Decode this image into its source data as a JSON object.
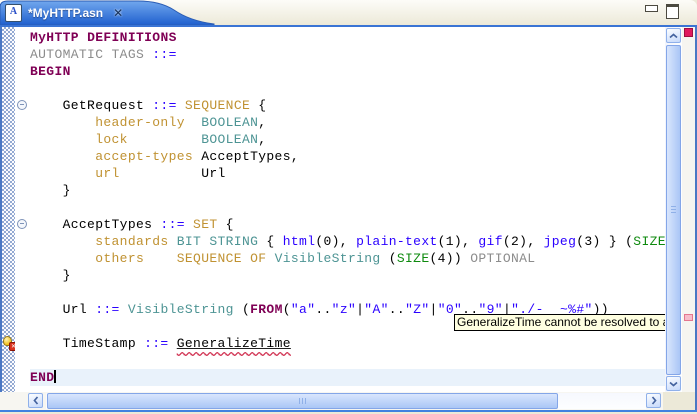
{
  "tab": {
    "title": "*MyHTTP.asn",
    "close_glyph": "✕",
    "icon_letter": "A"
  },
  "tooltip": {
    "text": "GeneralizeTime cannot be resolved to a type"
  },
  "palette": {
    "fg": "#000000",
    "kw": "#7f0055",
    "gray": "#8c8c8c",
    "blue": "#2a00ff",
    "gold": "#c09232",
    "teal": "#4d9494",
    "green": "#0e8a0e",
    "errred": "#d03050",
    "curline": "#e9f2fb",
    "tipbg": "#ffffe1",
    "tab_top": "#71a7ee",
    "tab_bottom": "#1f5fce"
  },
  "editor": {
    "lines": [
      [
        [
          "k",
          "MyHTTP"
        ],
        [
          "d",
          " "
        ],
        [
          "k",
          "DEFINITIONS"
        ]
      ],
      [
        [
          "g",
          "AUTOMATIC TAGS"
        ],
        [
          "d",
          " "
        ],
        [
          "b",
          "::="
        ]
      ],
      [
        [
          "k",
          "BEGIN"
        ]
      ],
      [],
      [
        [
          "d",
          "    GetRequest "
        ],
        [
          "b",
          "::="
        ],
        [
          "d",
          " "
        ],
        [
          "gold",
          "SEQUENCE"
        ],
        [
          "d",
          " {"
        ]
      ],
      [
        [
          "d",
          "        "
        ],
        [
          "gold",
          "header-only"
        ],
        [
          "d",
          "  "
        ],
        [
          "t",
          "BOOLEAN"
        ],
        [
          "d",
          ","
        ]
      ],
      [
        [
          "d",
          "        "
        ],
        [
          "gold",
          "lock"
        ],
        [
          "d",
          "         "
        ],
        [
          "t",
          "BOOLEAN"
        ],
        [
          "d",
          ","
        ]
      ],
      [
        [
          "d",
          "        "
        ],
        [
          "gold",
          "accept-types"
        ],
        [
          "d",
          " AcceptTypes,"
        ]
      ],
      [
        [
          "d",
          "        "
        ],
        [
          "gold",
          "url"
        ],
        [
          "d",
          "          Url"
        ]
      ],
      [
        [
          "d",
          "    }"
        ]
      ],
      [],
      [
        [
          "d",
          "    AcceptTypes "
        ],
        [
          "b",
          "::="
        ],
        [
          "d",
          " "
        ],
        [
          "gold",
          "SET"
        ],
        [
          "d",
          " {"
        ]
      ],
      [
        [
          "d",
          "        "
        ],
        [
          "gold",
          "standards"
        ],
        [
          "d",
          " "
        ],
        [
          "t",
          "BIT STRING"
        ],
        [
          "d",
          " { "
        ],
        [
          "b",
          "html"
        ],
        [
          "d",
          "(0), "
        ],
        [
          "b",
          "plain-text"
        ],
        [
          "d",
          "(1), "
        ],
        [
          "b",
          "gif"
        ],
        [
          "d",
          "(2), "
        ],
        [
          "b",
          "jpeg"
        ],
        [
          "d",
          "(3) } ("
        ],
        [
          "grn",
          "SIZE"
        ],
        [
          "d",
          "("
        ]
      ],
      [
        [
          "d",
          "        "
        ],
        [
          "gold",
          "others"
        ],
        [
          "d",
          "    "
        ],
        [
          "gold",
          "SEQUENCE OF"
        ],
        [
          "d",
          " "
        ],
        [
          "t",
          "VisibleString"
        ],
        [
          "d",
          " ("
        ],
        [
          "grn",
          "SIZE"
        ],
        [
          "d",
          "(4)) "
        ],
        [
          "g",
          "OPTIONAL"
        ]
      ],
      [
        [
          "d",
          "    }"
        ]
      ],
      [],
      [
        [
          "d",
          "    Url "
        ],
        [
          "b",
          "::="
        ],
        [
          "d",
          " "
        ],
        [
          "t",
          "VisibleString"
        ],
        [
          "d",
          " ("
        ],
        [
          "k",
          "FROM"
        ],
        [
          "d",
          "("
        ],
        [
          "b",
          "\"a\""
        ],
        [
          "d",
          ".."
        ],
        [
          "b",
          "\"z\""
        ],
        [
          "d",
          "|"
        ],
        [
          "b",
          "\"A\""
        ],
        [
          "d",
          ".."
        ],
        [
          "b",
          "\"Z\""
        ],
        [
          "d",
          "|"
        ],
        [
          "b",
          "\"0\""
        ],
        [
          "d",
          ".."
        ],
        [
          "b",
          "\"9\""
        ],
        [
          "d",
          "|"
        ],
        [
          "b",
          "\"./-_ ~%#\""
        ],
        [
          "d",
          "))"
        ]
      ],
      [],
      [
        [
          "d",
          "    TimeStamp "
        ],
        [
          "b",
          "::="
        ],
        [
          "d",
          " "
        ],
        [
          "err",
          "GeneralizeTime"
        ]
      ],
      [],
      [
        [
          "k",
          "END"
        ]
      ]
    ],
    "current_line_index": 20,
    "caret_line_index": 20,
    "fold_marker_lines": [
      4,
      11
    ],
    "error_marker_line": 18,
    "range_indicator_lines": [
      17,
      18
    ]
  }
}
